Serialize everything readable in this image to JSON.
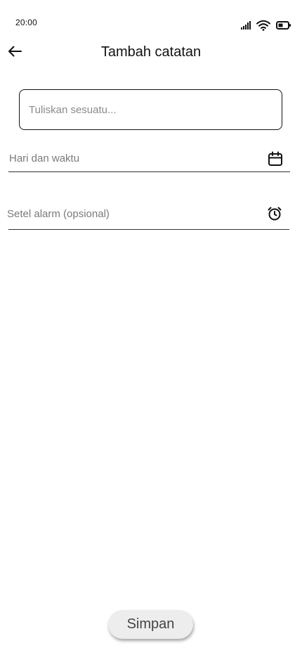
{
  "status_bar": {
    "time": "20:00",
    "icons": [
      "signal-icon",
      "wifi-icon",
      "battery-icon"
    ]
  },
  "app_bar": {
    "back_icon": "arrow-left-icon",
    "title": "Tambah catatan"
  },
  "form": {
    "note_input": {
      "value": "",
      "placeholder": "Tuliskan sesuatu..."
    },
    "datetime_field": {
      "label": "Hari dan waktu",
      "icon": "calendar-icon"
    },
    "alarm_field": {
      "label": "Setel alarm (opsional)",
      "icon": "alarm-clock-icon"
    }
  },
  "actions": {
    "save_label": "Simpan"
  }
}
